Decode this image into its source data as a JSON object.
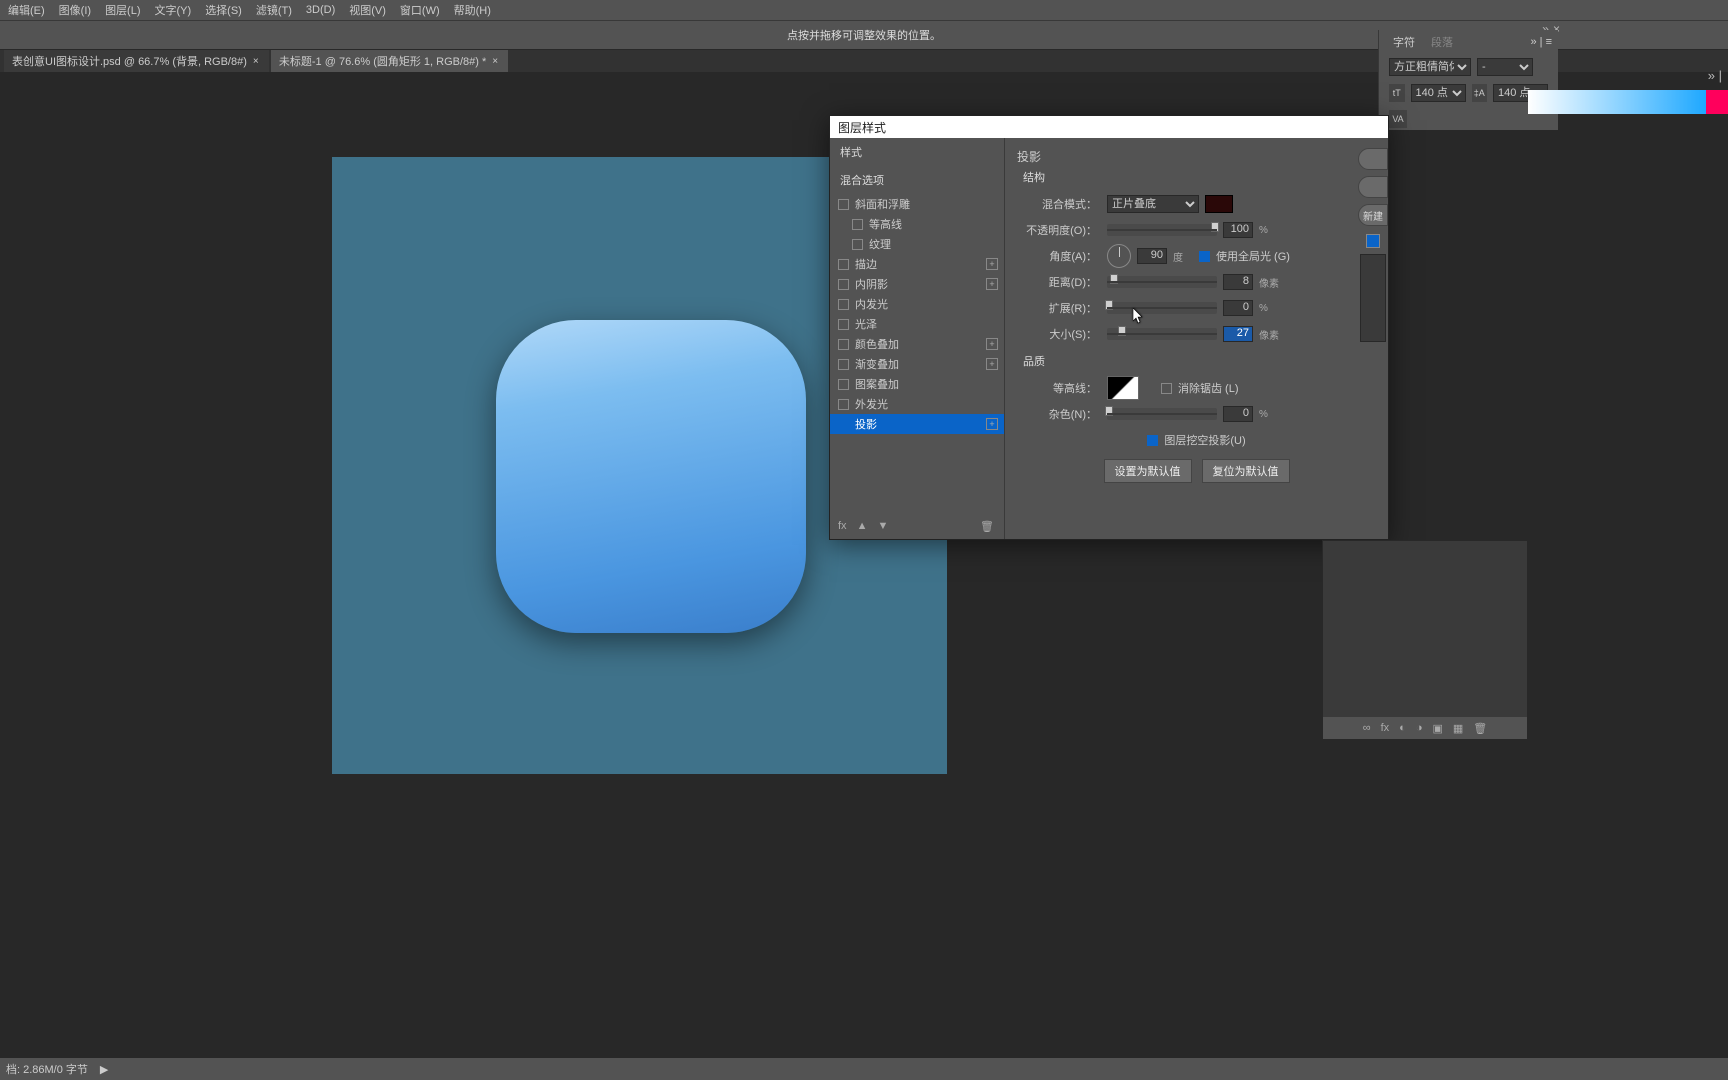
{
  "menu": [
    "编辑(E)",
    "图像(I)",
    "图层(L)",
    "文字(Y)",
    "选择(S)",
    "滤镜(T)",
    "3D(D)",
    "视图(V)",
    "窗口(W)",
    "帮助(H)"
  ],
  "optbar_hint": "点按并拖移可调整效果的位置。",
  "tabs": [
    {
      "label": "表创意UI图标设计.psd @ 66.7% (背景, RGB/8#)",
      "active": false
    },
    {
      "label": "未标题-1 @ 76.6% (圆角矩形 1, RGB/8#) *",
      "active": true
    }
  ],
  "char_panel": {
    "tab1": "字符",
    "tab2": "段落",
    "font": "方正粗倩简体",
    "style": "-",
    "size": "140 点",
    "leading": "140 点",
    "va": "VA"
  },
  "dialog": {
    "title": "图层样式",
    "left": {
      "hdr1": "样式",
      "hdr2": "混合选项",
      "items": [
        {
          "label": "斜面和浮雕",
          "cb": false,
          "plus": false,
          "indent": 0
        },
        {
          "label": "等高线",
          "cb": false,
          "plus": false,
          "indent": 1
        },
        {
          "label": "纹理",
          "cb": false,
          "plus": false,
          "indent": 1
        },
        {
          "label": "描边",
          "cb": false,
          "plus": true,
          "indent": 0
        },
        {
          "label": "内阴影",
          "cb": false,
          "plus": true,
          "indent": 0
        },
        {
          "label": "内发光",
          "cb": false,
          "plus": false,
          "indent": 0
        },
        {
          "label": "光泽",
          "cb": false,
          "plus": false,
          "indent": 0
        },
        {
          "label": "颜色叠加",
          "cb": false,
          "plus": true,
          "indent": 0
        },
        {
          "label": "渐变叠加",
          "cb": false,
          "plus": true,
          "indent": 0
        },
        {
          "label": "图案叠加",
          "cb": false,
          "plus": false,
          "indent": 0
        },
        {
          "label": "外发光",
          "cb": false,
          "plus": false,
          "indent": 0
        },
        {
          "label": "投影",
          "cb": true,
          "plus": true,
          "indent": 0,
          "sel": true
        }
      ],
      "fx": "fx"
    },
    "right": {
      "title": "投影",
      "sub": "结构",
      "blend_label": "混合模式：",
      "blend_value": "正片叠底",
      "opacity_label": "不透明度(O)：",
      "opacity_val": "100",
      "opacity_unit": "%",
      "angle_label": "角度(A)：",
      "angle_val": "90",
      "angle_unit": "度",
      "global_label": "使用全局光 (G)",
      "global_on": true,
      "distance_label": "距离(D)：",
      "distance_val": "8",
      "distance_unit": "像素",
      "spread_label": "扩展(R)：",
      "spread_val": "0",
      "spread_unit": "%",
      "size_label": "大小(S)：",
      "size_val": "27",
      "size_unit": "像素",
      "quality": "品质",
      "contour_label": "等高线：",
      "aa_label": "消除锯齿 (L)",
      "noise_label": "杂色(N)：",
      "noise_val": "0",
      "noise_unit": "%",
      "knockout_label": "图层挖空投影(U)",
      "knockout_on": true,
      "btn1": "设置为默认值",
      "btn2": "复位为默认值"
    },
    "side_new": "新建"
  },
  "layers_tools": [
    "∞",
    "fx",
    "◐",
    "◑",
    "▣",
    "▦",
    "🗑"
  ],
  "status": "档: 2.86M/0 字节"
}
